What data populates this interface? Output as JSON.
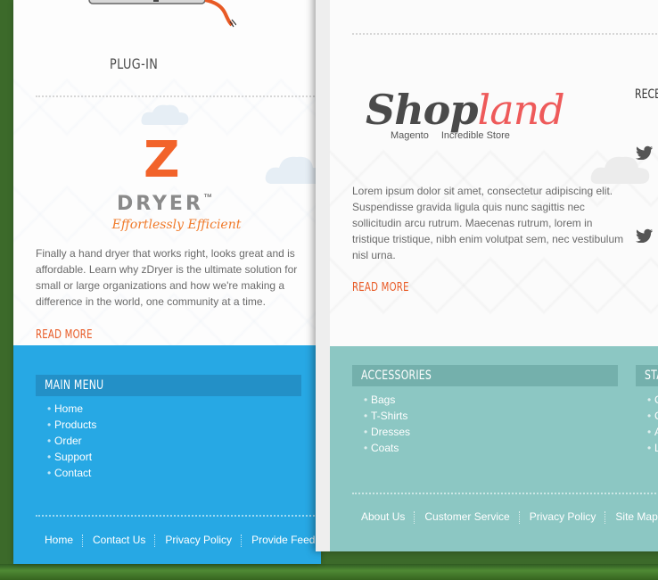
{
  "left_card": {
    "plugin_label": "PLUG-IN",
    "zdryer": {
      "logo_letter": "Z",
      "logo_word": "DRYER",
      "logo_tm": "™",
      "logo_slogan": "Effortlessly Efficient",
      "description": "Finally a hand dryer that works right, looks great and is affordable. Learn why zDryer is the ultimate solution for small or large organizations and how we're making a difference in the world, one community at a time.",
      "read_more": "READ MORE"
    },
    "footer": {
      "menu_title": "MAIN MENU",
      "menu_items": [
        "Home",
        "Products",
        "Order",
        "Support",
        "Contact"
      ],
      "links": [
        "Home",
        "Contact Us",
        "Privacy Policy",
        "Provide Feed"
      ]
    }
  },
  "right_card": {
    "shopland": {
      "logo_part1": "Shop",
      "logo_part2": "land",
      "tag_left": "Magento",
      "tag_right": "Incredible Store",
      "description": "Lorem ipsum dolor sit amet, consectetur adipiscing elit. Suspendisse gravida ligula quis nunc sagittis nec sollicitudin arcu rutrum. Maecenas rutrum, lorem in tristique tristique, nibh enim volutpat sem, nec vestibulum nisl urna.",
      "read_more": "READ MORE"
    },
    "recent_heading": "RECE",
    "footer": {
      "accessories_title": "ACCESSORIES",
      "accessories_items": [
        "Bags",
        "T-Shirts",
        "Dresses",
        "Coats"
      ],
      "second_title": "STA",
      "second_items": [
        "C",
        "C",
        "A",
        "L"
      ],
      "links": [
        "About Us",
        "Customer Service",
        "Privacy Policy",
        "Site Map"
      ]
    }
  },
  "colors": {
    "accent_orange": "#e85a25",
    "left_footer_blue": "#27a8e4",
    "right_footer_teal": "#8cc7c3",
    "shopland_red": "#ee5a5a",
    "shopland_gray": "#4a4a4a"
  }
}
